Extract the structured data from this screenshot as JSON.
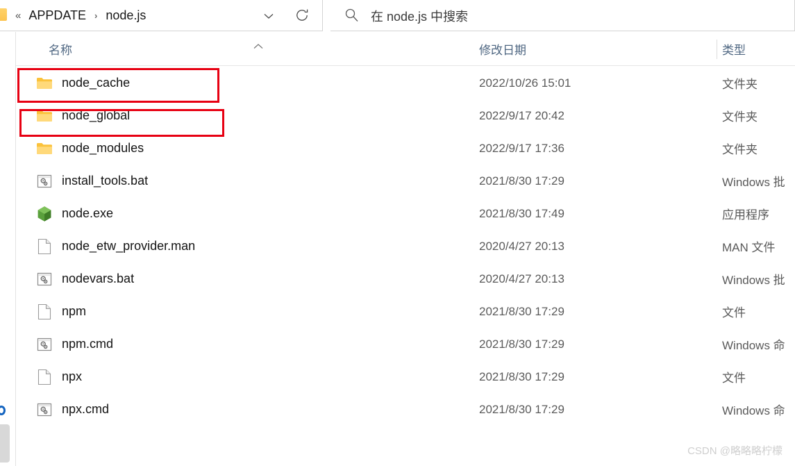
{
  "window": {
    "address_bar": {
      "overflow_chevrons": "«",
      "crumbs": [
        "APPDATE",
        "node.js"
      ],
      "separator": "›",
      "dropdown_icon": "chevron-down-icon",
      "refresh_icon": "refresh-icon"
    },
    "search": {
      "icon": "search-icon",
      "placeholder": "在 node.js 中搜索",
      "value": ""
    }
  },
  "sidebar": {
    "clipped_label": "al"
  },
  "columns": {
    "name": "名称",
    "date_modified": "修改日期",
    "type": "类型",
    "sort_indicator": "caret-up-icon"
  },
  "files": [
    {
      "name": "node_cache",
      "icon": "folder-icon",
      "date": "2022/10/26 15:01",
      "type": "文件夹"
    },
    {
      "name": "node_global",
      "icon": "folder-icon",
      "date": "2022/9/17 20:42",
      "type": "文件夹"
    },
    {
      "name": "node_modules",
      "icon": "folder-icon",
      "date": "2022/9/17 17:36",
      "type": "文件夹"
    },
    {
      "name": "install_tools.bat",
      "icon": "bat-file-icon",
      "date": "2021/8/30 17:29",
      "type": "Windows 批"
    },
    {
      "name": "node.exe",
      "icon": "node-exe-icon",
      "date": "2021/8/30 17:49",
      "type": "应用程序"
    },
    {
      "name": "node_etw_provider.man",
      "icon": "blank-file-icon",
      "date": "2020/4/27 20:13",
      "type": "MAN 文件"
    },
    {
      "name": "nodevars.bat",
      "icon": "bat-file-icon",
      "date": "2020/4/27 20:13",
      "type": "Windows 批"
    },
    {
      "name": "npm",
      "icon": "blank-file-icon",
      "date": "2021/8/30 17:29",
      "type": "文件"
    },
    {
      "name": "npm.cmd",
      "icon": "bat-file-icon",
      "date": "2021/8/30 17:29",
      "type": "Windows 命"
    },
    {
      "name": "npx",
      "icon": "blank-file-icon",
      "date": "2021/8/30 17:29",
      "type": "文件"
    },
    {
      "name": "npx.cmd",
      "icon": "bat-file-icon",
      "date": "2021/8/30 17:29",
      "type": "Windows 命"
    }
  ],
  "annotations": {
    "color": "#e70012",
    "boxes": [
      {
        "target": "node_cache"
      },
      {
        "target": "node_global"
      }
    ]
  },
  "watermark": {
    "text": "CSDN @略略略柠檬"
  }
}
